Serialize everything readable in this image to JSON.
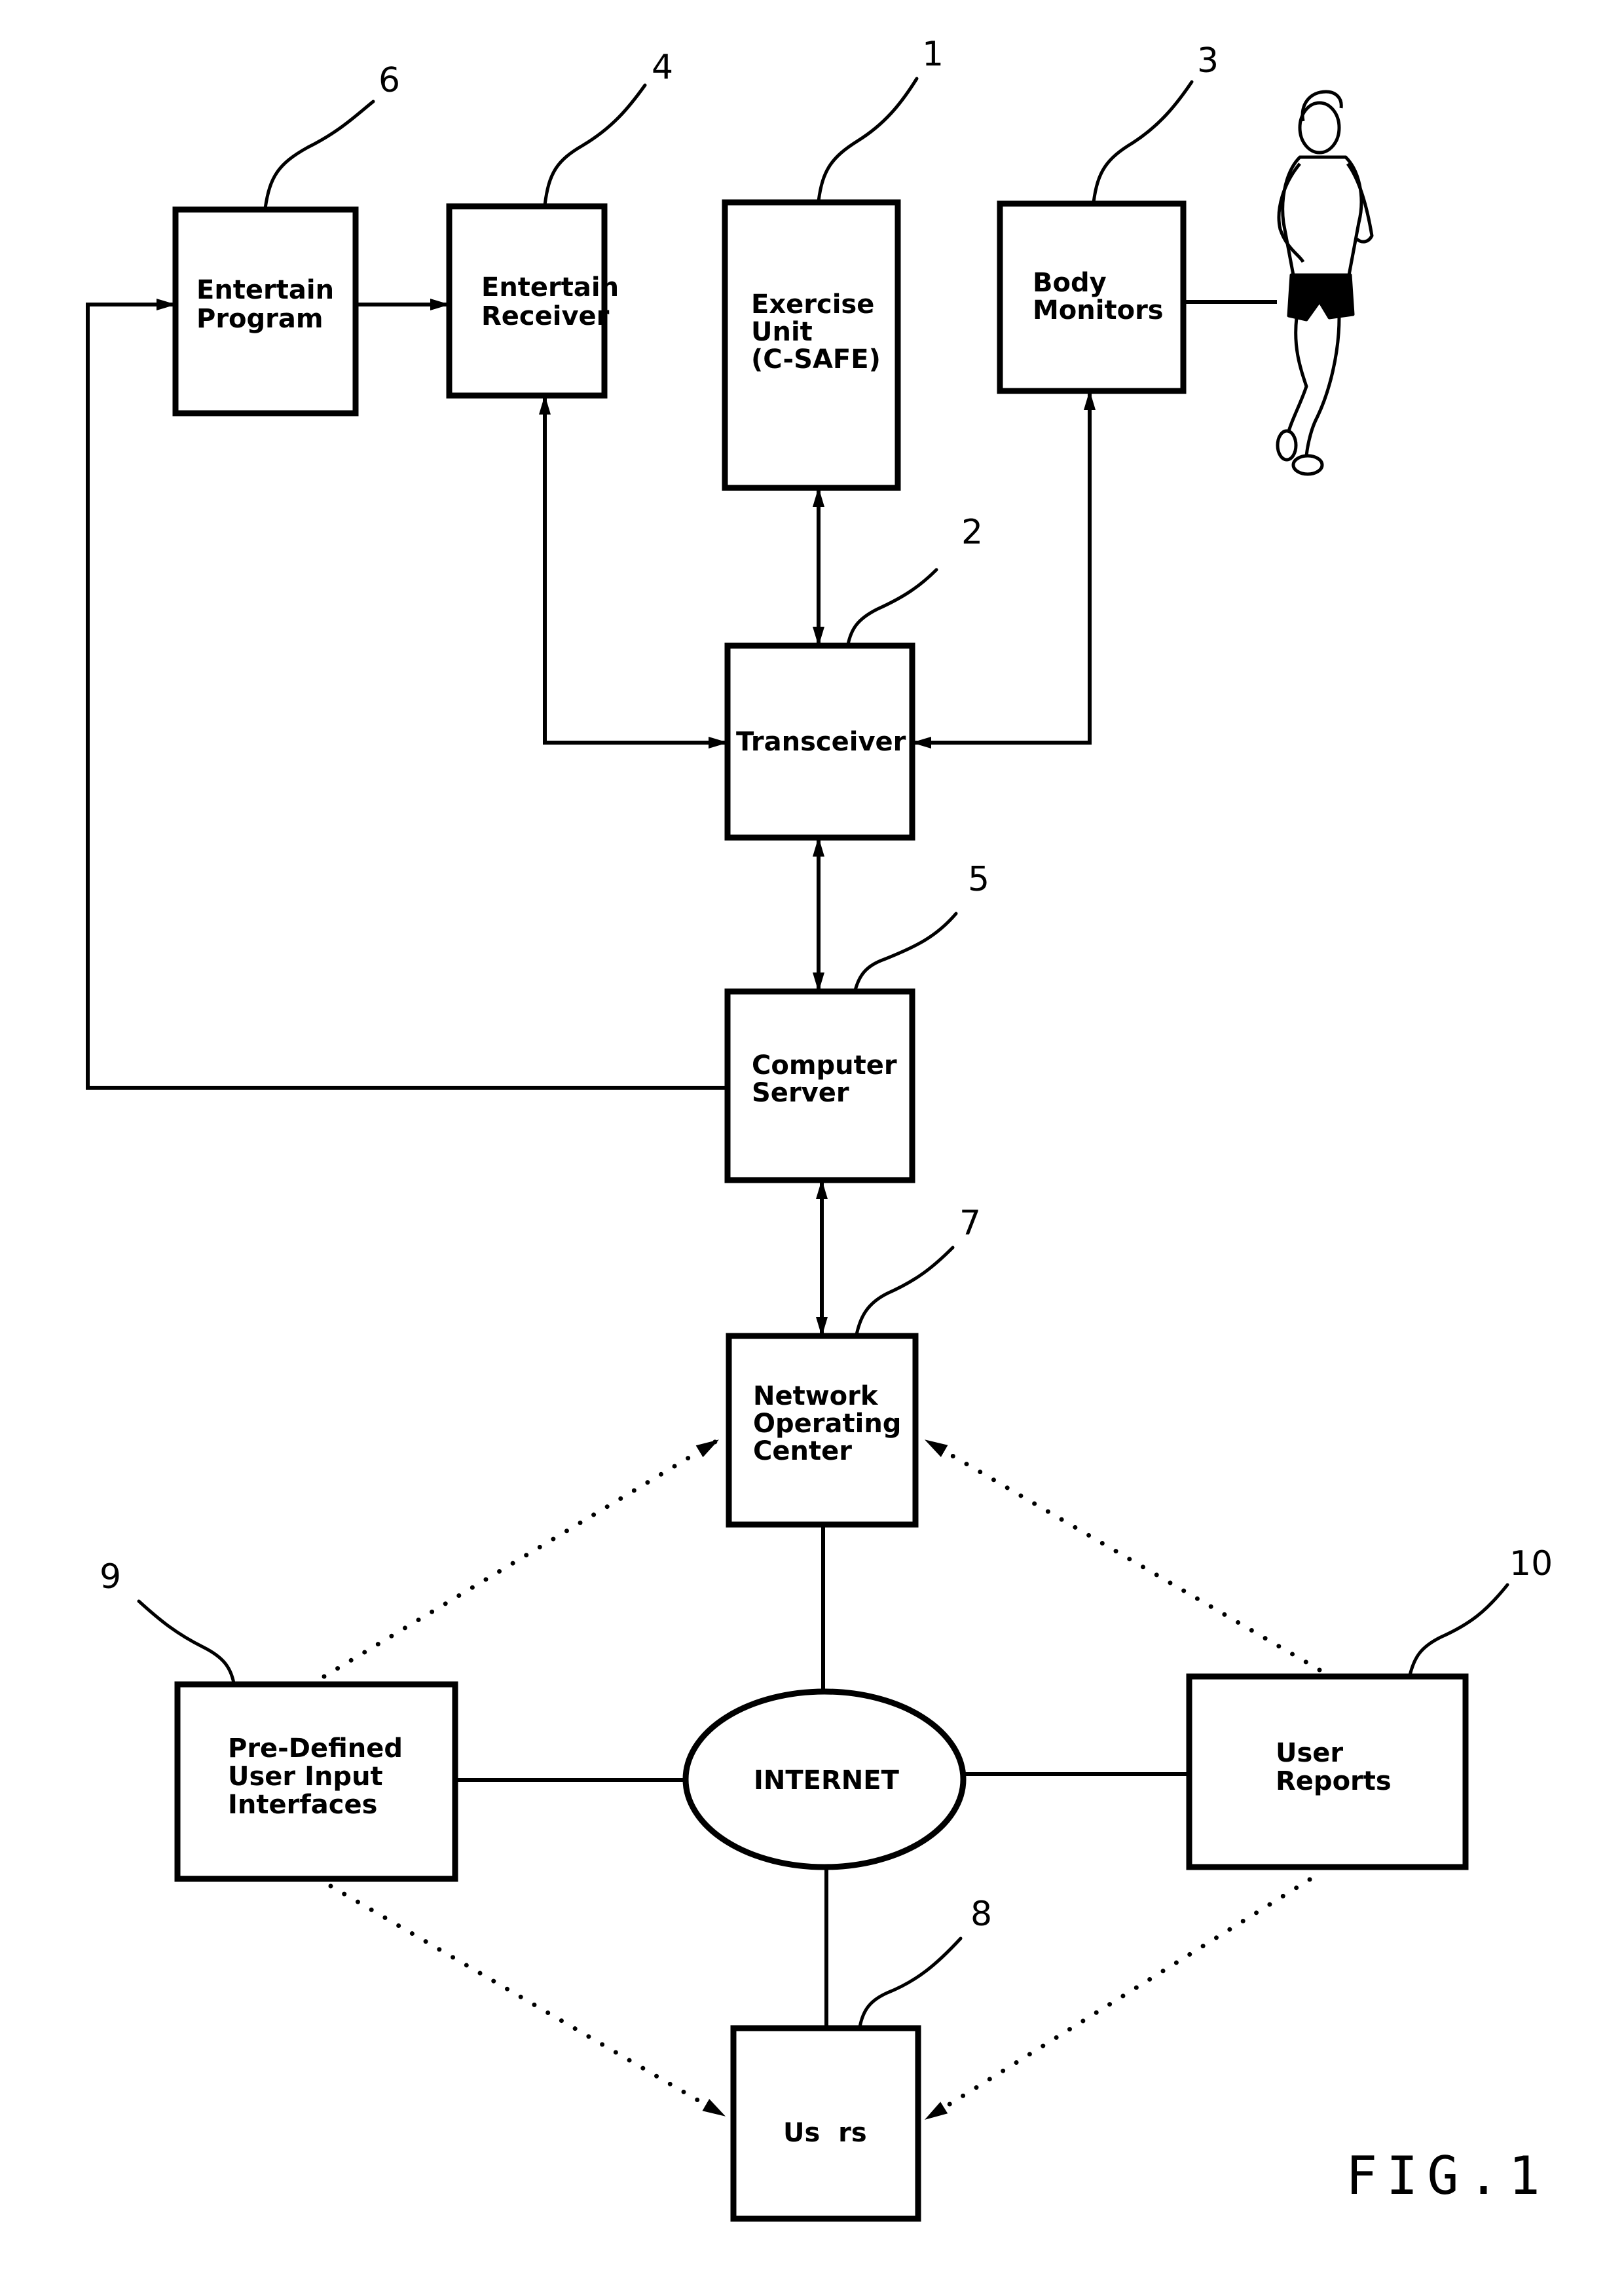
{
  "figure_label": "FIG.1",
  "blocks": {
    "entertain_program": {
      "ref": "6",
      "lines": [
        "Entertain",
        "Program"
      ]
    },
    "entertain_receiver": {
      "ref": "4",
      "lines": [
        "Entertain",
        "Receiver"
      ]
    },
    "exercise_unit": {
      "ref": "1",
      "lines": [
        "Exercise",
        "Unit",
        "(C-SAFE)"
      ]
    },
    "body_monitors": {
      "ref": "3",
      "lines": [
        "Body",
        "Monitors"
      ]
    },
    "transceiver": {
      "ref": "2",
      "lines": [
        "Transceiver"
      ]
    },
    "computer_server": {
      "ref": "5",
      "lines": [
        "Computer",
        "Server"
      ]
    },
    "network_operating_center": {
      "ref": "7",
      "lines": [
        "Network",
        "Operating",
        "Center"
      ]
    },
    "internet": {
      "lines": [
        "INTERNET"
      ]
    },
    "user_input_interfaces": {
      "ref": "9",
      "lines": [
        "Pre-Defined",
        "User Input",
        "Interfaces"
      ]
    },
    "user_reports": {
      "ref": "10",
      "lines": [
        "User",
        "Reports"
      ]
    },
    "users": {
      "ref": "8",
      "lines": [
        "Us  rs"
      ]
    }
  },
  "illustration": {
    "subject": "running-woman"
  }
}
